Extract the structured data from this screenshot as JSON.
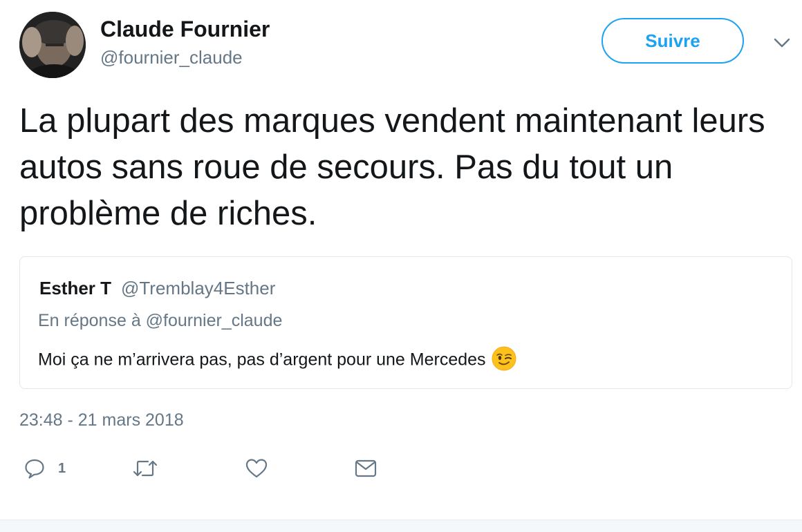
{
  "author": {
    "name": "Claude Fournier",
    "handle": "@fournier_claude"
  },
  "follow_label": "Suivre",
  "tweet": {
    "text": "La plupart des marques vendent maintenant leurs autos sans roue de secours. Pas du tout un problème de riches.",
    "timestamp": "23:48 - 21 mars 2018"
  },
  "quoted": {
    "name": "Esther T",
    "handle": "@Tremblay4Esther",
    "reply_context": "En réponse à @fournier_claude",
    "text": "Moi ça ne m’arrivera pas, pas d’argent pour une Mercedes",
    "emoji": "winking-face"
  },
  "actions": {
    "reply_count": "1",
    "icons": [
      "reply-icon",
      "retweet-icon",
      "like-icon",
      "direct-message-icon"
    ]
  },
  "colors": {
    "accent": "#1da1f2",
    "secondary_text": "#657786",
    "icon": "#657786",
    "border": "#e1e8ed"
  }
}
